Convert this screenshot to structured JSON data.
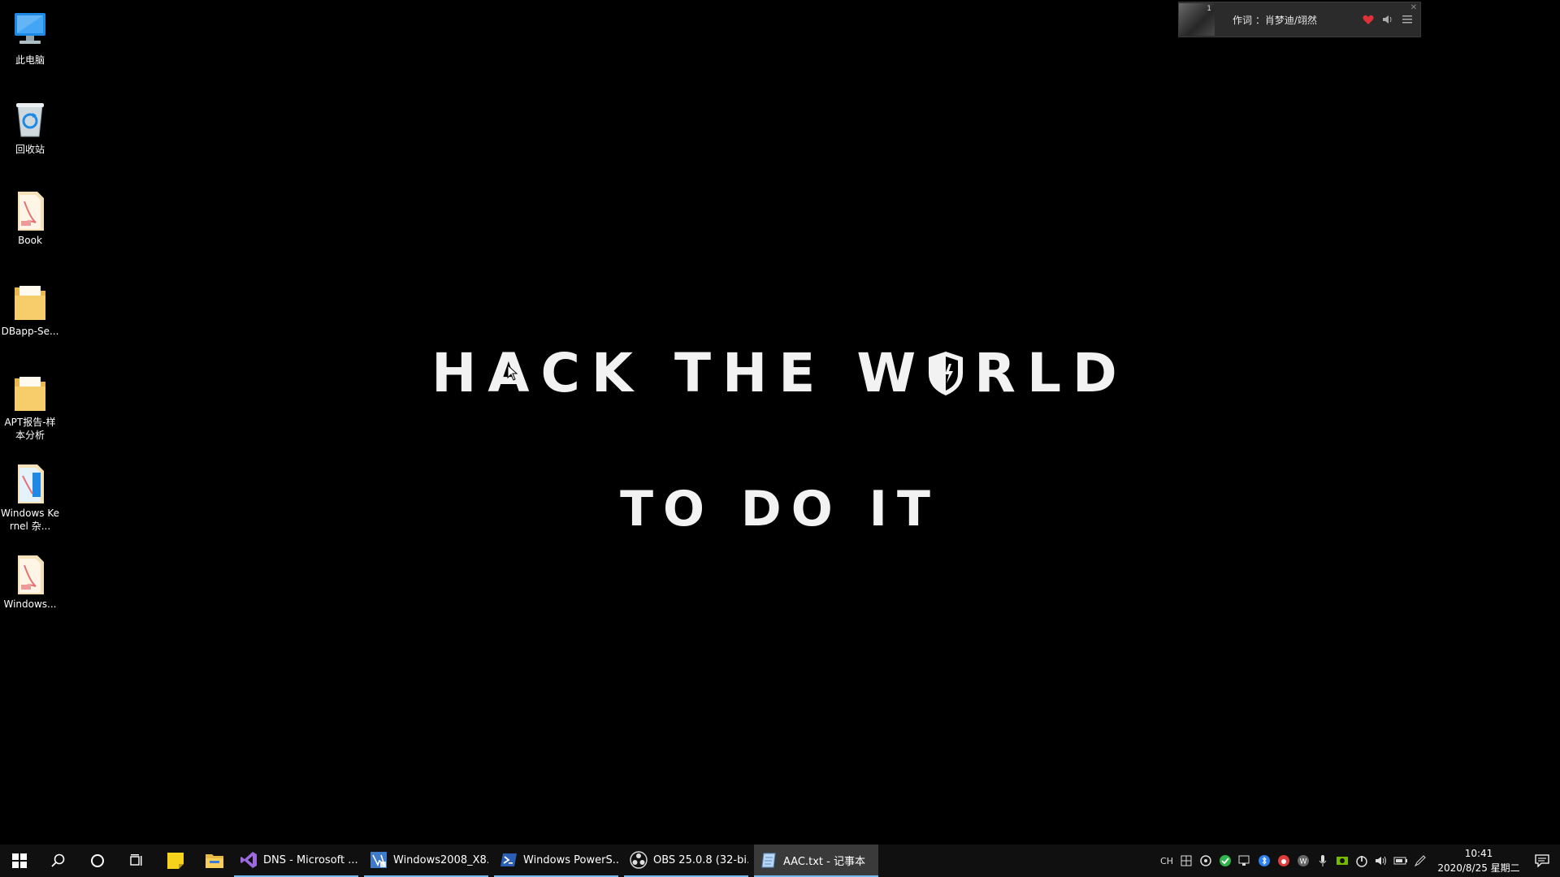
{
  "desktop": {
    "icons": [
      {
        "label": "此电脑",
        "icon": "computer-icon"
      },
      {
        "label": "回收站",
        "icon": "recycle-bin-icon"
      },
      {
        "label": "Book",
        "icon": "pdf-file-icon"
      },
      {
        "label": "DBapp-Se...",
        "icon": "folder-icon"
      },
      {
        "label": "APT报告-样本分析",
        "icon": "folder-icon"
      },
      {
        "label": "Windows Kernel 杂...",
        "icon": "pdf-file-icon"
      },
      {
        "label": "Windows...",
        "icon": "pdf-file-icon"
      }
    ],
    "wallpaper": {
      "title_part1": "HACK THE W",
      "title_part2": "RLD",
      "subtitle": "TO DO IT",
      "text_color": "#f2f2f2"
    }
  },
  "music_player": {
    "track_number": "1",
    "lyric": "作词 ：肖梦迪/翊然",
    "heart_color": "#e0303a"
  },
  "taskbar": {
    "apps": [
      {
        "label": "DNS - Microsoft ...",
        "icon": "visual-studio-icon",
        "active": false
      },
      {
        "label": "Windows2008_X8...",
        "icon": "vmware-icon",
        "active": false
      },
      {
        "label": "Windows PowerS...",
        "icon": "powershell-icon",
        "active": false
      },
      {
        "label": "OBS 25.0.8 (32-bi...",
        "icon": "obs-icon",
        "active": false
      },
      {
        "label": "AAC.txt - 记事本",
        "icon": "notepad-icon",
        "active": true
      }
    ],
    "tray": {
      "ime": "CH",
      "time": "10:41",
      "date": "2020/8/25 星期二"
    },
    "accent_color": "#76b9ed"
  }
}
